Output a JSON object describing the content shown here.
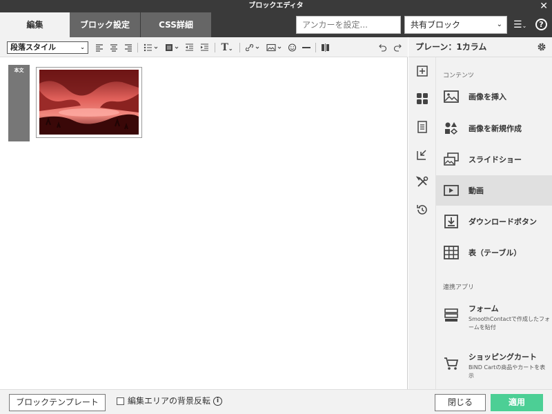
{
  "window": {
    "title": "ブロックエディタ"
  },
  "tabs": [
    {
      "label": "編集"
    },
    {
      "label": "ブロック設定"
    },
    {
      "label": "CSS詳細"
    }
  ],
  "anchor": {
    "placeholder": "アンカーを設定..."
  },
  "shared_block": {
    "label": "共有ブロック"
  },
  "toolbar": {
    "paragraph_style": "段落スタイル",
    "text_style_glyph": "T"
  },
  "editor": {
    "body_tag": "本文"
  },
  "panel": {
    "title": "プレーン：1カラム",
    "sections": [
      {
        "label": "コンテンツ",
        "items": [
          {
            "label": "画像を挿入",
            "icon": "image-icon"
          },
          {
            "label": "画像を新規作成",
            "icon": "shapes-icon"
          },
          {
            "label": "スライドショー",
            "icon": "slideshow-icon"
          },
          {
            "label": "動画",
            "icon": "video-icon",
            "active": true
          },
          {
            "label": "ダウンロードボタン",
            "icon": "download-icon"
          },
          {
            "label": "表（テーブル）",
            "icon": "table-icon"
          }
        ]
      },
      {
        "label": "連携アプリ",
        "items": [
          {
            "label": "フォーム",
            "desc": "SmoothContactで作成したフォームを貼付",
            "icon": "form-icon"
          },
          {
            "label": "ショッピングカート",
            "desc": "BiND Cartの商品やカートを表示",
            "icon": "cart-icon"
          }
        ]
      }
    ]
  },
  "footer": {
    "template_button": "ブロックテンプレート",
    "bg_invert_label": "編集エリアの背景反転",
    "close_button": "閉じる",
    "apply_button": "適用"
  },
  "colors": {
    "apply_green": "#4ccf95",
    "dark_bar": "#3a3a3a",
    "tab_gray": "#666666"
  }
}
